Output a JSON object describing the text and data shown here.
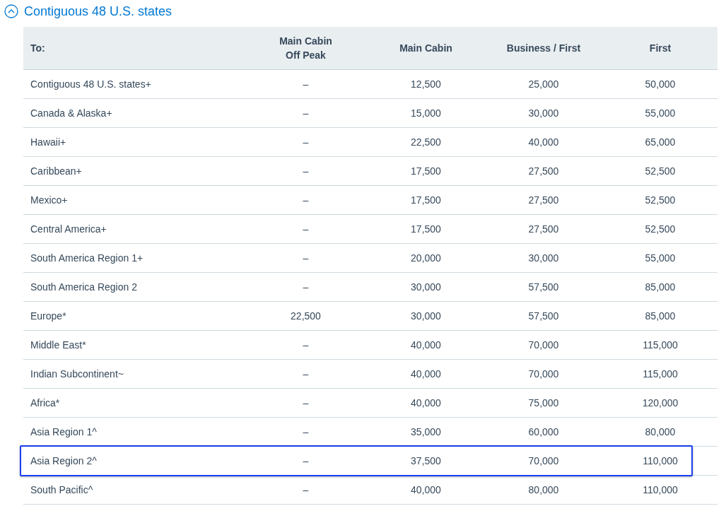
{
  "section": {
    "title": "Contiguous 48 U.S. states",
    "expanded": true
  },
  "table": {
    "columns": [
      "To:",
      "Main Cabin\nOff Peak",
      "Main Cabin",
      "Business / First",
      "First"
    ],
    "rows": [
      {
        "cells": [
          "Contiguous 48 U.S. states+",
          "–",
          "12,500",
          "25,000",
          "50,000"
        ],
        "highlighted": false
      },
      {
        "cells": [
          "Canada & Alaska+",
          "–",
          "15,000",
          "30,000",
          "55,000"
        ],
        "highlighted": false
      },
      {
        "cells": [
          "Hawaii+",
          "–",
          "22,500",
          "40,000",
          "65,000"
        ],
        "highlighted": false
      },
      {
        "cells": [
          "Caribbean+",
          "–",
          "17,500",
          "27,500",
          "52,500"
        ],
        "highlighted": false
      },
      {
        "cells": [
          "Mexico+",
          "–",
          "17,500",
          "27,500",
          "52,500"
        ],
        "highlighted": false
      },
      {
        "cells": [
          "Central America+",
          "–",
          "17,500",
          "27,500",
          "52,500"
        ],
        "highlighted": false
      },
      {
        "cells": [
          "South America Region 1+",
          "–",
          "20,000",
          "30,000",
          "55,000"
        ],
        "highlighted": false
      },
      {
        "cells": [
          "South America Region 2",
          "–",
          "30,000",
          "57,500",
          "85,000"
        ],
        "highlighted": false
      },
      {
        "cells": [
          "Europe*",
          "22,500",
          "30,000",
          "57,500",
          "85,000"
        ],
        "highlighted": false
      },
      {
        "cells": [
          "Middle East*",
          "–",
          "40,000",
          "70,000",
          "115,000"
        ],
        "highlighted": false
      },
      {
        "cells": [
          "Indian Subcontinent~",
          "–",
          "40,000",
          "70,000",
          "115,000"
        ],
        "highlighted": false
      },
      {
        "cells": [
          "Africa*",
          "–",
          "40,000",
          "75,000",
          "120,000"
        ],
        "highlighted": false
      },
      {
        "cells": [
          "Asia Region 1^",
          "–",
          "35,000",
          "60,000",
          "80,000"
        ],
        "highlighted": false
      },
      {
        "cells": [
          "Asia Region 2^",
          "–",
          "37,500",
          "70,000",
          "110,000"
        ],
        "highlighted": true
      },
      {
        "cells": [
          "South Pacific^",
          "–",
          "40,000",
          "80,000",
          "110,000"
        ],
        "highlighted": false
      }
    ]
  }
}
